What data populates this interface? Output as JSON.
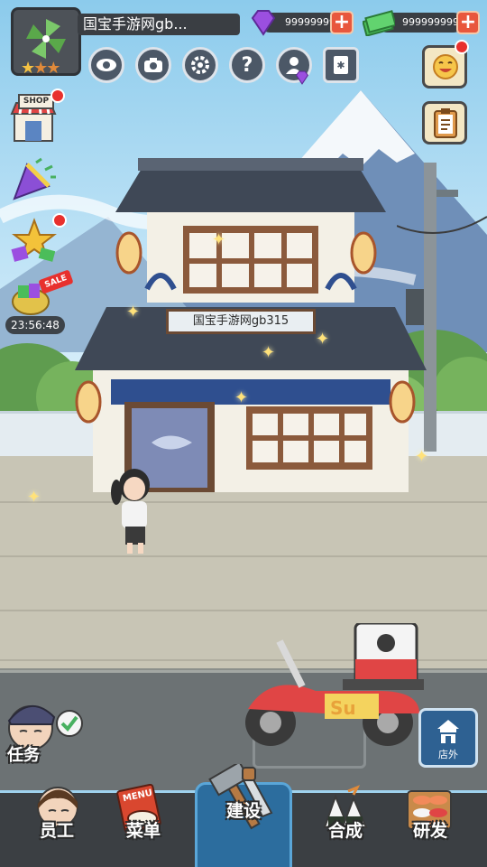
{
  "player": {
    "name": "国宝手游网gb...",
    "stars": 3,
    "avatar_icon": "green-pinwheel-icon"
  },
  "currency": {
    "gems": "999999999",
    "cash": "999999999"
  },
  "toolbar_icons": [
    "eye-icon",
    "camera-icon",
    "gear-icon",
    "help-icon",
    "profile-icon",
    "album-icon"
  ],
  "side_menu": {
    "shop_label": "SHOP",
    "sale_label": "SALE",
    "sale_timer": "23:56:48"
  },
  "shop": {
    "sign_text": "国宝手游网gb315"
  },
  "scooter": {
    "brand_text": "Su"
  },
  "tasks": {
    "label": "任务"
  },
  "outside_button": {
    "label": "店外"
  },
  "nav": {
    "staff": "员工",
    "menu": "菜单",
    "build": "建设",
    "merge": "合成",
    "research": "研发",
    "menu_book_text": "MENU"
  },
  "colors": {
    "accent_red": "#e8302d",
    "nav_background": "#3b3f43",
    "build_highlight": "#2c6d9e"
  }
}
